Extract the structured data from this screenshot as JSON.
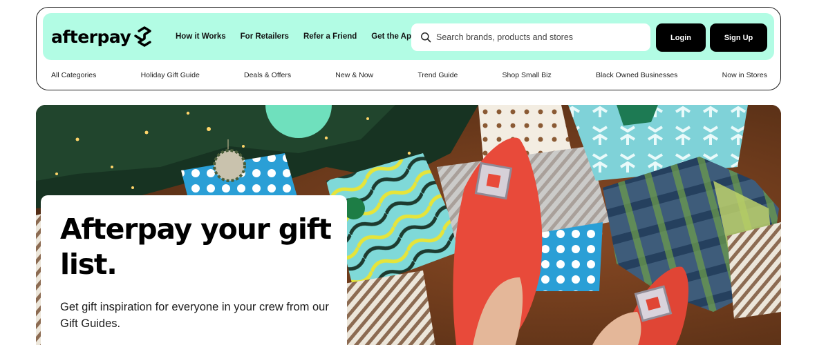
{
  "header": {
    "logo_text": "afterpay",
    "nav_links": [
      "How it Works",
      "For Retailers",
      "Refer a Friend",
      "Get the App"
    ],
    "search": {
      "placeholder": "Search brands, products and stores",
      "value": ""
    },
    "login_label": "Login",
    "signup_label": "Sign Up"
  },
  "categories": [
    "All Categories",
    "Holiday Gift Guide",
    "Deals & Offers",
    "New & Now",
    "Trend Guide",
    "Shop Small Biz",
    "Black Owned Businesses",
    "Now in Stores"
  ],
  "hero": {
    "title": "Afterpay your gift list.",
    "subtitle": "Get gift inspiration for everyone in your crew from our Gift Guides."
  },
  "colors": {
    "brand_mint": "#b2fce4",
    "button_black": "#000000"
  },
  "icons": {
    "logo_mark": "afterpay-arrows-icon",
    "search": "search-icon"
  }
}
